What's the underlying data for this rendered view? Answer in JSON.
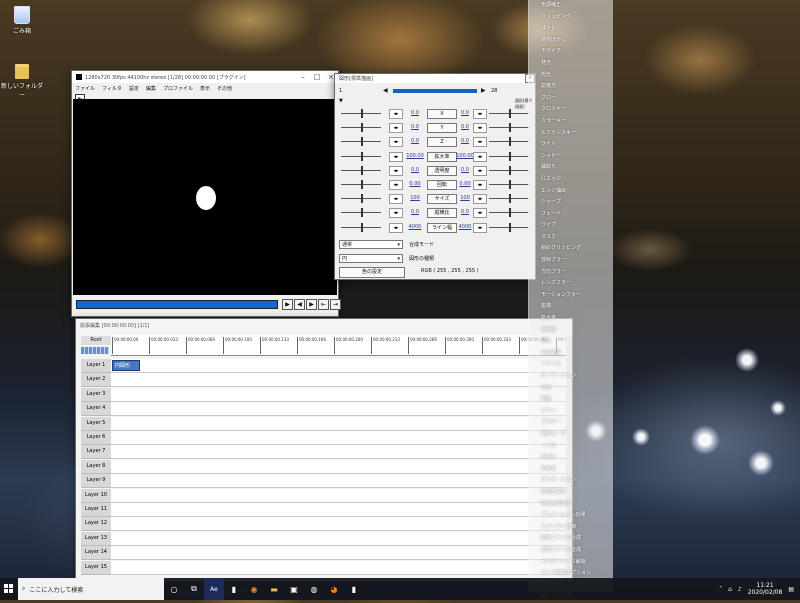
{
  "desktop": {
    "icons": [
      {
        "label": "ごみ箱",
        "icon": "recycle-bin-icon"
      },
      {
        "label": "新しいフォルダー",
        "icon": "folder-icon"
      }
    ]
  },
  "main_window": {
    "title": "1280x720  30fps  44100hz  stereo  [1/28]  00:00:00.00  [プラグイン]",
    "menu": [
      "ファイル",
      "フィルタ",
      "設定",
      "編集",
      "プロファイル",
      "表示",
      "その他"
    ]
  },
  "settings_dialog": {
    "title": "図形[標準描画]",
    "frame_start": "1",
    "frame_end": "28",
    "toggle_label": "図形[標準描画]",
    "rows": [
      {
        "left": "0.0",
        "label": "X",
        "right": "0.0"
      },
      {
        "left": "0.0",
        "label": "Y",
        "right": "0.0"
      },
      {
        "left": "0.0",
        "label": "Z",
        "right": "0.0"
      },
      {
        "left": "100.00",
        "label": "拡大率",
        "right": "100.00"
      },
      {
        "left": "0.0",
        "label": "透明度",
        "right": "0.0"
      },
      {
        "left": "0.00",
        "label": "回転",
        "right": "0.00"
      },
      {
        "left": "100",
        "label": "サイズ",
        "right": "100"
      },
      {
        "left": "0.0",
        "label": "縦横比",
        "right": "0.0"
      },
      {
        "left": "4000",
        "label": "ライン幅",
        "right": "4000"
      }
    ],
    "blend_mode_value": "通常",
    "blend_mode_label": "合成モード",
    "shape_value": "円",
    "shape_label": "図形の種類",
    "color_button": "色の設定",
    "rgb_text": "RGB ( 255 , 255 , 255 )"
  },
  "timeline": {
    "title": "拡張編集 [00:00:00.00] [1/1]",
    "root_label": "Root",
    "time_ticks": [
      "00:00:00.00",
      "00:00:00.033",
      "00:00:00.066",
      "00:00:00.100",
      "00:00:00.133",
      "00:00:00.166",
      "00:00:00.200",
      "00:00:00.233",
      "00:00:00.266",
      "00:00:00.300",
      "00:00:00.333",
      "00:00:00.366",
      "00:00:00.400"
    ],
    "clip_label": "円図形",
    "layers": [
      "Layer 1",
      "Layer 2",
      "Layer 3",
      "Layer 4",
      "Layer 5",
      "Layer 6",
      "Layer 7",
      "Layer 8",
      "Layer 9",
      "Layer 10",
      "Layer 11",
      "Layer 12",
      "Layer 13",
      "Layer 14",
      "Layer 15"
    ]
  },
  "context_menu": {
    "items": [
      "色調補正",
      "クリッピング",
      "ぼかし",
      "境界ぼかし",
      "モザイク",
      "発光",
      "閃光",
      "拡散光",
      "グロー",
      "クロマキー",
      "カラーキー",
      "ルミナンスキー",
      "ライト",
      "シャドー",
      "縁取り",
      "凸エッジ",
      "エッジ抽出",
      "シャープ",
      "フェード",
      "ワイプ",
      "マスク",
      "斜めクリッピング",
      "放射ブラー",
      "方向ブラー",
      "レンズブラー",
      "モーションブラー",
      "座標",
      "拡大率",
      "透明度",
      "回転",
      "領域拡張",
      "リサイズ",
      "ローテーション",
      "反転",
      "振動",
      "ミラー",
      "ラスター",
      "画像ループ",
      "ノイズ",
      "色ずれ",
      "単色化",
      "グラデーション",
      "拡張色設定",
      "特定色域変換",
      "アニメーション効果",
      "スクリプト制御",
      "動画ファイル合成",
      "画像ファイル合成",
      "インターレース解除",
      "カメラ制御オプション",
      "オフスクリーン描画",
      "部分フィルタ"
    ]
  },
  "taskbar": {
    "search_placeholder": "ここに入力して検索",
    "time": "11:21",
    "date": "2020/02/08"
  }
}
